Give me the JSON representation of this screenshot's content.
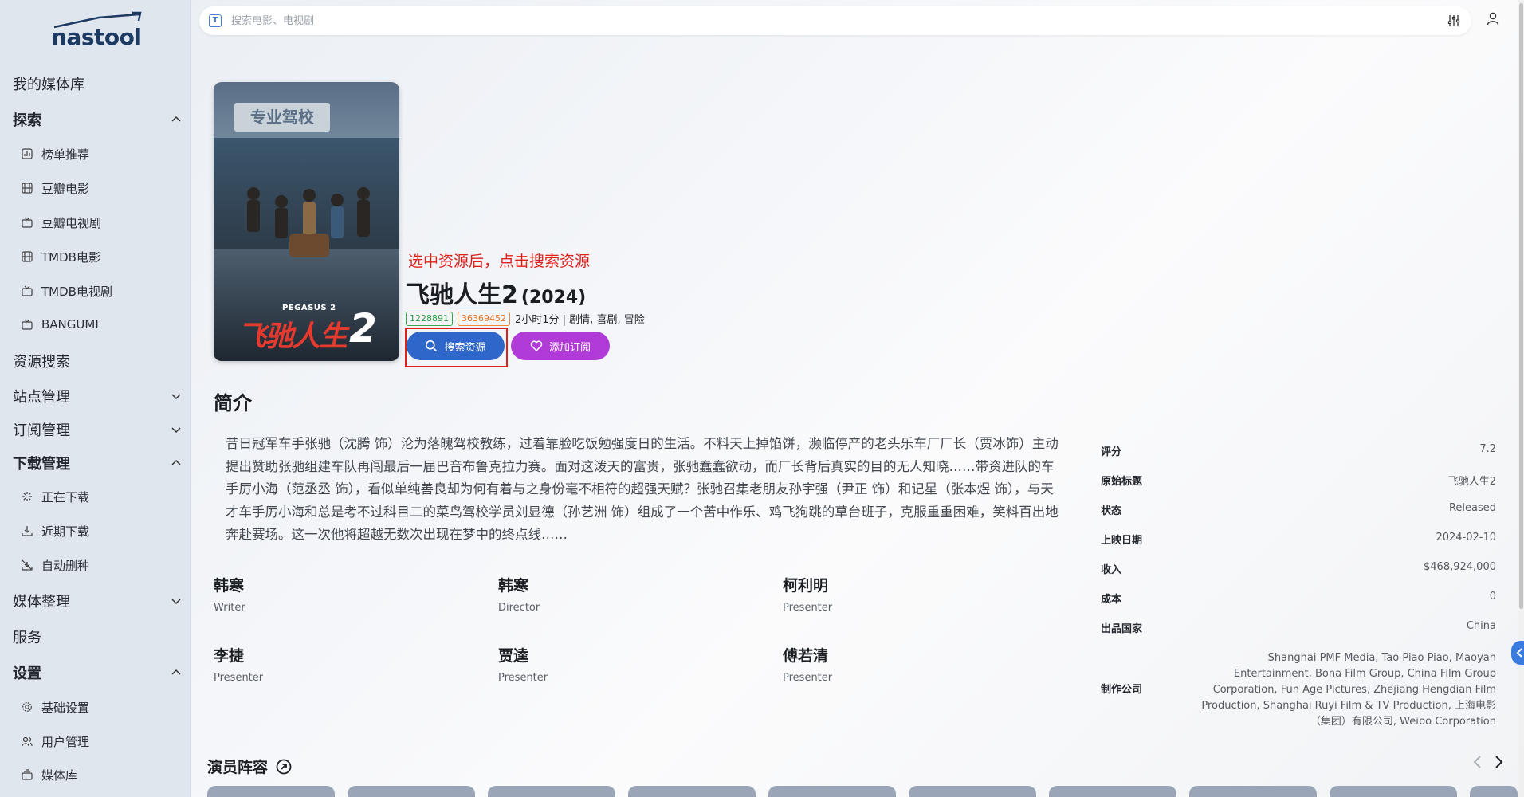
{
  "logo": {
    "text": "nastool"
  },
  "search": {
    "placeholder": "搜索电影、电视剧",
    "icon": "T"
  },
  "sidebar": {
    "items": [
      {
        "label": "我的媒体库"
      },
      {
        "label": "探索"
      },
      {
        "label": "榜单推荐"
      },
      {
        "label": "豆瓣电影"
      },
      {
        "label": "豆瓣电视剧"
      },
      {
        "label": "TMDB电影"
      },
      {
        "label": "TMDB电视剧"
      },
      {
        "label": "BANGUMI"
      },
      {
        "label": "资源搜索"
      },
      {
        "label": "站点管理"
      },
      {
        "label": "订阅管理"
      },
      {
        "label": "下载管理"
      },
      {
        "label": "正在下载"
      },
      {
        "label": "近期下载"
      },
      {
        "label": "自动删种"
      },
      {
        "label": "媒体整理"
      },
      {
        "label": "服务"
      },
      {
        "label": "设置"
      },
      {
        "label": "基础设置"
      },
      {
        "label": "用户管理"
      },
      {
        "label": "媒体库"
      }
    ]
  },
  "poster": {
    "en_title": "PEGASUS 2",
    "zh_title": "飞驰人生",
    "num": "2",
    "sign": "专业驾校"
  },
  "annotation": "选中资源后，点击搜索资源",
  "detail": {
    "title": "飞驰人生2",
    "year": "(2024)",
    "tmdb_id": "1228891",
    "douban_id": "36369452",
    "meta_text": "2小时1分 | 剧情, 喜剧, 冒险",
    "btn_search": "搜索资源",
    "btn_subscribe": "添加订阅"
  },
  "overview": {
    "heading": "简介",
    "text": "昔日冠军车手张驰（沈腾 饰）沦为落魄驾校教练，过着靠脸吃饭勉强度日的生活。不料天上掉馅饼，濒临停产的老头乐车厂厂长（贾冰饰）主动提出赞助张驰组建车队再闯最后一届巴音布鲁克拉力赛。面对这泼天的富贵，张驰蠢蠢欲动，而厂长背后真实的目的无人知晓……带资进队的车手厉小海（范丞丞 饰），看似单纯善良却为何有着与之身份毫不相符的超强天赋？张驰召集老朋友孙宇强（尹正 饰）和记星（张本煜 饰），与天才车手厉小海和总是考不过科目二的菜鸟驾校学员刘显德（孙艺洲 饰）组成了一个苦中作乐、鸡飞狗跳的草台班子，克服重重困难，笑料百出地奔赴赛场。这一次他将超越无数次出现在梦中的终点线……"
  },
  "crew": [
    {
      "name": "韩寒",
      "role": "Writer"
    },
    {
      "name": "韩寒",
      "role": "Director"
    },
    {
      "name": "柯利明",
      "role": "Presenter"
    },
    {
      "name": "李捷",
      "role": "Presenter"
    },
    {
      "name": "贾逵",
      "role": "Presenter"
    },
    {
      "name": "傅若清",
      "role": "Presenter"
    }
  ],
  "facts": [
    {
      "key": "评分",
      "value": "7.2"
    },
    {
      "key": "原始标题",
      "value": "飞驰人生2"
    },
    {
      "key": "状态",
      "value": "Released"
    },
    {
      "key": "上映日期",
      "value": "2024-02-10"
    },
    {
      "key": "收入",
      "value": "$468,924,000"
    },
    {
      "key": "成本",
      "value": "0"
    },
    {
      "key": "出品国家",
      "value": "China"
    },
    {
      "key": "制作公司",
      "value": "Shanghai PMF Media, Tao Piao Piao, Maoyan Entertainment, Bona Film Group, China Film Group Corporation, Fun Age Pictures, Zhejiang Hengdian Film Production, Shanghai Ruyi Film & TV Production, 上海电影（集团）有限公司, Weibo Corporation"
    }
  ],
  "cast": {
    "heading": "演员阵容"
  },
  "colors": {
    "primary_button": "#2e66c9",
    "subscribe_button": "#b03bd6",
    "annotation": "#e0201b",
    "sidebar_bg": "#dfe6ee"
  }
}
